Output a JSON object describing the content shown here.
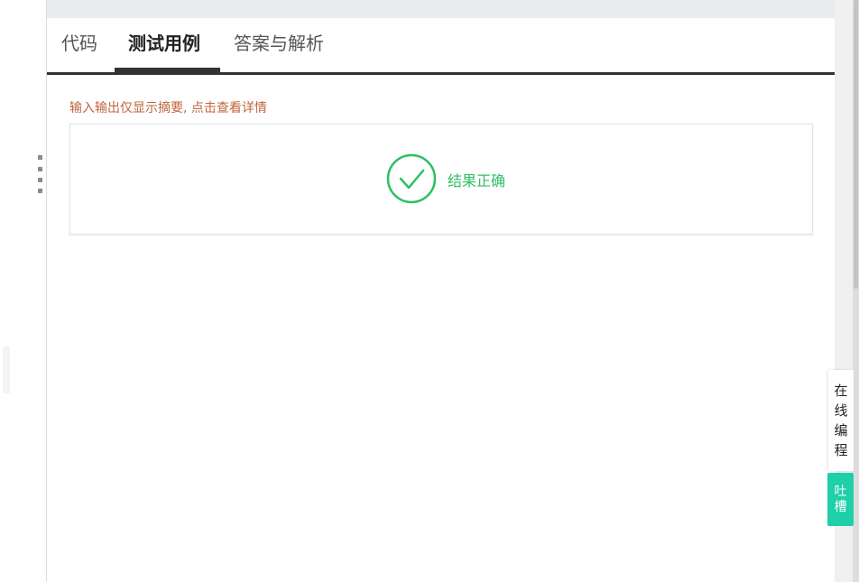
{
  "tabs": [
    {
      "label": "代码",
      "active": false
    },
    {
      "label": "测试用例",
      "active": true
    },
    {
      "label": "答案与解析",
      "active": false
    }
  ],
  "hint": "输入输出仅显示摘要, 点击查看详情",
  "result": {
    "icon": "check-circle-icon",
    "text": "结果正确",
    "color": "#2dbf62"
  },
  "floating": {
    "online_coding_chars": [
      "在",
      "线",
      "编",
      "程"
    ],
    "feedback_chars": [
      "吐",
      "槽"
    ],
    "feedback_color": "#1fcfa8"
  },
  "colors": {
    "hint": "#c0643e",
    "tab_active": "#222222",
    "tab_inactive": "#555555"
  }
}
